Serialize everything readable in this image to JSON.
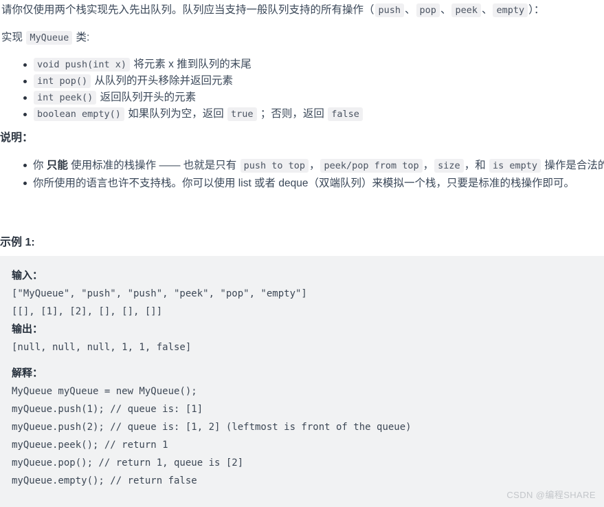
{
  "document": {
    "intro": {
      "t1": "请你仅使用两个栈实现先入先出队列。队列应当支持一般队列支持的所有操作（",
      "c1": "push",
      "t2": "、",
      "c2": "pop",
      "t3": "、",
      "c3": "peek",
      "t4": "、",
      "c4": "empty",
      "t5": "）："
    },
    "implement_line": {
      "t1": "实现 ",
      "c1": "MyQueue",
      "t2": " 类:"
    },
    "api_list": [
      {
        "code": "void push(int x)",
        "text": " 将元素 x 推到队列的末尾"
      },
      {
        "code": "int pop()",
        "text": " 从队列的开头移除并返回元素"
      },
      {
        "code": "int peek()",
        "text": " 返回队列开头的元素"
      },
      {
        "code": "boolean empty()",
        "text": " 如果队列为空，返回 ",
        "code2": "true",
        "text2": " ；否则，返回 ",
        "code3": "false"
      }
    ],
    "note_heading": "说明：",
    "notes": {
      "item1": {
        "t1": "你 ",
        "bold": "只能",
        "t2": " 使用标准的栈操作 —— 也就是只有 ",
        "c1": "push to top",
        "t3": "，",
        "c2": "peek/pop from top",
        "t4": "，",
        "c3": "size",
        "t5": "，和 ",
        "c4": "is empty",
        "t6": " 操作是合法的。"
      },
      "item2": "你所使用的语言也许不支持栈。你可以使用 list 或者 deque（双端队列）来模拟一个栈，只要是标准的栈操作即可。"
    },
    "example_heading": "示例 1:",
    "example_block": {
      "input_label": "输入：",
      "input_line1": "[\"MyQueue\", \"push\", \"push\", \"peek\", \"pop\", \"empty\"]",
      "input_line2": "[[], [1], [2], [], [], []]",
      "output_label": "输出：",
      "output_line1": "[null, null, null, 1, 1, false]",
      "explain_label": "解释：",
      "code_lines": [
        "MyQueue myQueue = new MyQueue();",
        "myQueue.push(1); // queue is: [1]",
        "myQueue.push(2); // queue is: [1, 2] (leftmost is front of the queue)",
        "myQueue.peek(); // return 1",
        "myQueue.pop(); // return 1, queue is [2]",
        "myQueue.empty(); // return false"
      ]
    },
    "watermark": "CSDN @编程SHARE"
  }
}
